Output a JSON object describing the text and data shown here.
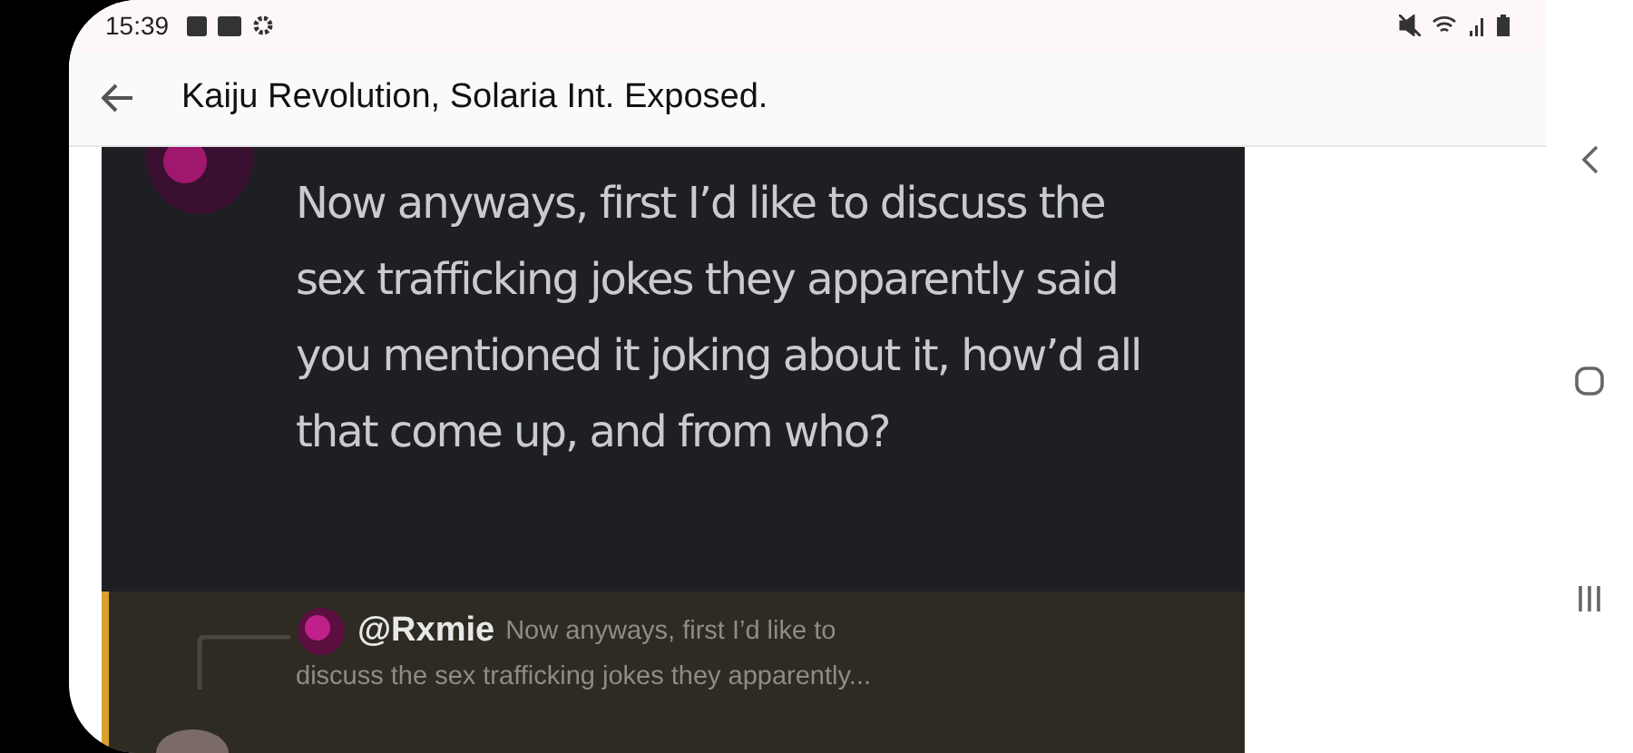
{
  "status_bar": {
    "time": "15:39"
  },
  "app_bar": {
    "title": "Kaiju Revolution, Solaria Int. Exposed."
  },
  "screenshot": {
    "message": {
      "text": "Now anyways, first I’d like to discuss the sex trafficking jokes they apparently said you mentioned it joking about it, how’d all that come up, and from who?"
    },
    "reply": {
      "author": "@Rxmie",
      "preview_lines": [
        "Now anyways, first I’d like to",
        "discuss the sex trafficking jokes they apparently..."
      ]
    }
  }
}
